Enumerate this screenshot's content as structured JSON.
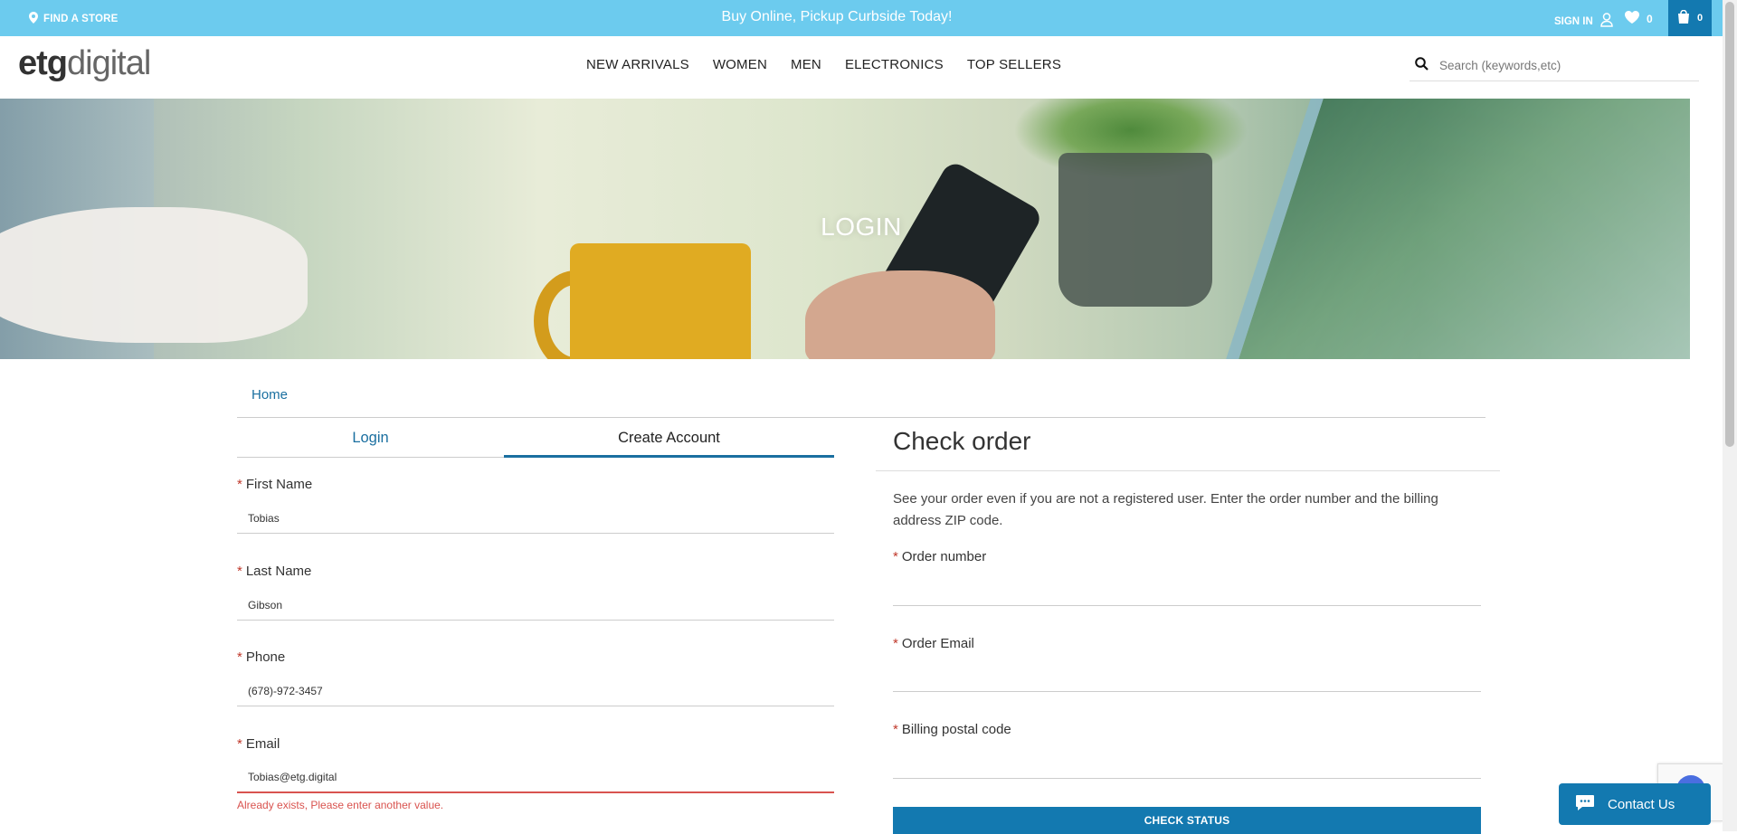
{
  "topbar": {
    "find_store": "FIND A STORE",
    "promo": "Buy Online, Pickup Curbside Today!",
    "sign_in": "SIGN IN",
    "wishlist_count": "0",
    "cart_count": "0",
    "background_color": "#6ccbee"
  },
  "header": {
    "logo_part1": "etg",
    "logo_part2": "digital",
    "nav": [
      "NEW ARRIVALS",
      "WOMEN",
      "MEN",
      "ELECTRONICS",
      "TOP SELLERS"
    ],
    "search_placeholder": "Search (keywords,etc)"
  },
  "hero": {
    "title": "LOGIN"
  },
  "breadcrumb": {
    "home": "Home"
  },
  "tabs": {
    "login": "Login",
    "create_account": "Create Account",
    "active": "Create Account"
  },
  "form": {
    "first_name": {
      "label": "First Name",
      "value": "Tobias"
    },
    "last_name": {
      "label": "Last Name",
      "value": "Gibson"
    },
    "phone": {
      "label": "Phone",
      "value": "(678)-972-3457"
    },
    "email": {
      "label": "Email",
      "value": "Tobias@etg.digital",
      "error": "Already exists, Please enter another value."
    }
  },
  "check_order": {
    "title": "Check order",
    "description": "See your order even if you are not a registered user. Enter the order number and the billing address ZIP code.",
    "order_number_label": "Order number",
    "order_email_label": "Order Email",
    "billing_postal_label": "Billing postal code",
    "button": "CHECK STATUS"
  },
  "contact": {
    "label": "Contact Us"
  },
  "colors": {
    "accent": "#1379b0",
    "link": "#1a6fa0",
    "error": "#d9534f",
    "required": "#c0392b"
  }
}
